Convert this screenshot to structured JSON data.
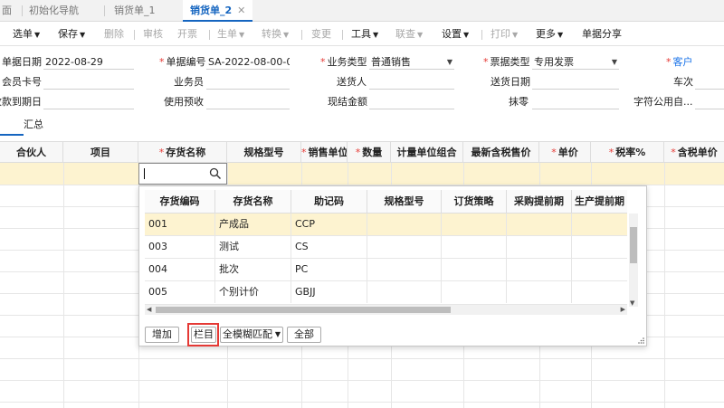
{
  "tabs": [
    {
      "label": "面"
    },
    {
      "label": "初始化导航"
    },
    {
      "label": "销货单_1"
    },
    {
      "label": "销货单_2",
      "active": true
    }
  ],
  "toolbar": {
    "items": [
      {
        "label": "选单",
        "dropdown": true,
        "disabled": false
      },
      {
        "label": "保存",
        "dropdown": true,
        "disabled": false
      },
      {
        "label": "删除",
        "dropdown": false,
        "disabled": true
      },
      {
        "label": "审核",
        "dropdown": false,
        "disabled": true
      },
      {
        "label": "开票",
        "dropdown": false,
        "disabled": true
      },
      {
        "label": "生单",
        "dropdown": true,
        "disabled": true
      },
      {
        "label": "转换",
        "dropdown": true,
        "disabled": true
      },
      {
        "label": "变更",
        "dropdown": false,
        "disabled": true
      },
      {
        "label": "工具",
        "dropdown": true,
        "disabled": false
      },
      {
        "label": "联查",
        "dropdown": true,
        "disabled": true
      },
      {
        "label": "设置",
        "dropdown": true,
        "disabled": false
      },
      {
        "label": "打印",
        "dropdown": true,
        "disabled": true
      },
      {
        "label": "更多",
        "dropdown": true,
        "disabled": false
      },
      {
        "label": "单据分享",
        "dropdown": false,
        "disabled": false
      }
    ]
  },
  "form": {
    "bill_date_label": "单据日期",
    "bill_date": "2022-08-29",
    "bill_no_label": "单据编号",
    "bill_no": "SA-2022-08-00-0...",
    "biz_type_label": "业务类型",
    "biz_type": "普通销售",
    "invoice_type_label": "票据类型",
    "invoice_type": "专用发票",
    "customer_label": "客户",
    "member_card_label": "会员卡号",
    "salesman_label": "业务员",
    "deliverer_label": "送货人",
    "delivery_date_label": "送货日期",
    "vehicle_label": "车次",
    "due_date_label": "收款到期日",
    "use_prepay_label": "使用预收",
    "cash_amount_label": "现结金额",
    "round_off_label": "抹零",
    "char_common_label": "字符公用自..."
  },
  "summary_tab": "汇总",
  "grid": {
    "headers": [
      {
        "label": "合伙人",
        "required": false
      },
      {
        "label": "项目",
        "required": false
      },
      {
        "label": "存货名称",
        "required": true
      },
      {
        "label": "规格型号",
        "required": false
      },
      {
        "label": "销售单位",
        "required": true
      },
      {
        "label": "数量",
        "required": true
      },
      {
        "label": "计量单位组合",
        "required": false
      },
      {
        "label": "最新含税售价",
        "required": false
      },
      {
        "label": "单价",
        "required": true
      },
      {
        "label": "税率%",
        "required": true
      },
      {
        "label": "含税单价",
        "required": true
      }
    ]
  },
  "popup": {
    "headers": [
      "存货编码",
      "存货名称",
      "助记码",
      "规格型号",
      "订货策略",
      "采购提前期",
      "生产提前期"
    ],
    "rows": [
      {
        "code": "001",
        "name": "产成品",
        "mnemonic": "CCP",
        "selected": true
      },
      {
        "code": "003",
        "name": "测试",
        "mnemonic": "CS",
        "selected": false
      },
      {
        "code": "004",
        "name": "批次",
        "mnemonic": "PC",
        "selected": false
      },
      {
        "code": "005",
        "name": "个别计价",
        "mnemonic": "GBJJ",
        "selected": false
      }
    ],
    "add_button": "增加",
    "columns_button": "栏目",
    "match_mode": "全模糊匹配",
    "all_button": "全部"
  },
  "colors": {
    "accent": "#1565c0",
    "selected_row": "#fdf3d0",
    "required_mark": "#e53935",
    "highlight_box": "#e53935"
  }
}
